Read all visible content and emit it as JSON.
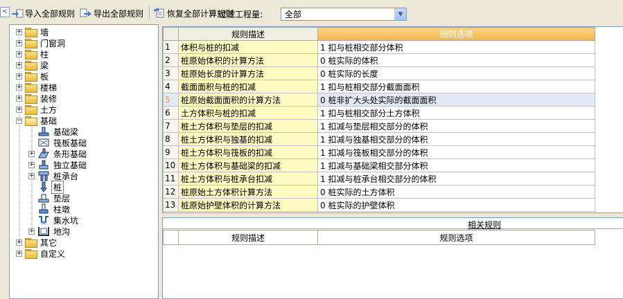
{
  "toolbar": {
    "collapse_glyph": "<",
    "import_label": "导入全部规则",
    "export_label": "导出全部规则",
    "restore_label": "恢复全部计算规则",
    "filter_label": "过滤工程量:",
    "filter_value": "全部"
  },
  "tree": {
    "items": [
      {
        "label": "墙",
        "expander": "+"
      },
      {
        "label": "门窗洞",
        "expander": "+"
      },
      {
        "label": "柱",
        "expander": "+"
      },
      {
        "label": "梁",
        "expander": "+"
      },
      {
        "label": "板",
        "expander": "+"
      },
      {
        "label": "楼梯",
        "expander": "+"
      },
      {
        "label": "装修",
        "expander": "+"
      },
      {
        "label": "土方",
        "expander": "+"
      },
      {
        "label": "基础",
        "expander": "−"
      },
      {
        "label": "基础梁"
      },
      {
        "label": "筏板基础"
      },
      {
        "label": "条形基础",
        "expander": "+"
      },
      {
        "label": "独立基础",
        "expander": "+"
      },
      {
        "label": "桩承台",
        "expander": "+"
      },
      {
        "label": "桩"
      },
      {
        "label": "垫层"
      },
      {
        "label": "柱墩"
      },
      {
        "label": "集水坑"
      },
      {
        "label": "地沟",
        "expander": "+"
      },
      {
        "label": "其它",
        "expander": "+"
      },
      {
        "label": "自定义",
        "expander": "+"
      }
    ]
  },
  "rules_table": {
    "col_desc": "规则描述",
    "col_option": "规则选项",
    "rows": [
      {
        "num": "1",
        "desc": "体积与桩的扣减",
        "option": "1  扣与桩相交部分体积"
      },
      {
        "num": "2",
        "desc": "桩原始体积的计算方法",
        "option": "0    桩实际的体积"
      },
      {
        "num": "3",
        "desc": "桩原始长度的计算方法",
        "option": "0    桩实际的长度"
      },
      {
        "num": "4",
        "desc": "截面面积与桩的扣减",
        "option": "1  扣与桩相交部分截面面积"
      },
      {
        "num": "5",
        "desc": "桩原始截面面积的计算方法",
        "option": "0    桩非扩大头处实际的截面面积"
      },
      {
        "num": "6",
        "desc": "土方体积与桩的扣减",
        "option": "1  扣与桩相交部分土方体积"
      },
      {
        "num": "7",
        "desc": "桩土方体积与垫层的扣减",
        "option": "1  扣减与垫层相交部分的体积"
      },
      {
        "num": "8",
        "desc": "桩土方体积与独基的扣减",
        "option": "1  扣减与独基相交部分的体积"
      },
      {
        "num": "9",
        "desc": "桩土方体积与筏板的扣减",
        "option": "1  扣减与筏板相交部分的体积"
      },
      {
        "num": "10",
        "desc": "桩土方体积与基础梁的扣减",
        "option": "1  扣减与基础梁相交部分体积"
      },
      {
        "num": "11",
        "desc": "桩土方体积与桩承台扣减",
        "option": "1  扣减与桩承台相交部分的体积"
      },
      {
        "num": "12",
        "desc": "桩原始土方体积计算方法",
        "option": "0  桩实际的土方体积"
      },
      {
        "num": "13",
        "desc": "桩原始护壁体积的计算方法",
        "option": "0    桩实际的护壁体积"
      }
    ]
  },
  "related": {
    "title": "相关规则",
    "col_desc": "规则描述",
    "col_option": "规则选项"
  }
}
